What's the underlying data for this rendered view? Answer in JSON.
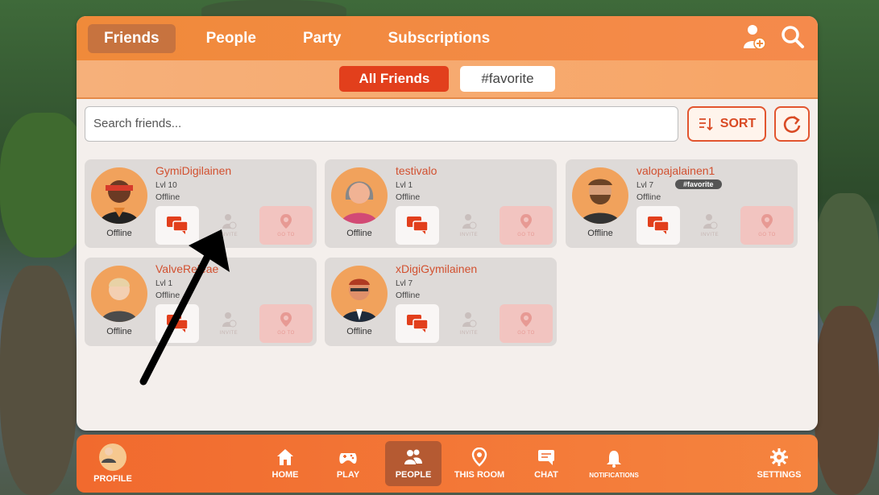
{
  "tabs": [
    "Friends",
    "People",
    "Party",
    "Subscriptions"
  ],
  "filters": {
    "all": "All Friends",
    "tag": "#favorite"
  },
  "search": {
    "placeholder": "Search friends..."
  },
  "sort_label": "SORT",
  "action_labels": {
    "invite": "INVITE",
    "goto": "GO TO"
  },
  "friends": [
    {
      "name": "GymiDigilainen",
      "level": "Lvl 10",
      "status": "Offline",
      "status_under": "Offline",
      "tag": ""
    },
    {
      "name": "testivalo",
      "level": "Lvl 1",
      "status": "Offline",
      "status_under": "Offline",
      "tag": ""
    },
    {
      "name": "valopajalainen1",
      "level": "Lvl 7",
      "status": "Offline",
      "status_under": "Offline",
      "tag": "#favorite"
    },
    {
      "name": "ValveReleae",
      "level": "Lvl 1",
      "status": "Offline",
      "status_under": "Offline",
      "tag": ""
    },
    {
      "name": "xDigiGymilainen",
      "level": "Lvl 7",
      "status": "Offline",
      "status_under": "Offline",
      "tag": ""
    }
  ],
  "nav": {
    "profile": "PROFILE",
    "home": "HOME",
    "play": "PLAY",
    "people": "PEOPLE",
    "this_room": "THIS ROOM",
    "chat": "CHAT",
    "notifications": "NOTIFICATIONS",
    "settings": "SETTINGS"
  },
  "colors": {
    "accent": "#f08a3a",
    "active_chip": "#e23f1c",
    "name": "#d2502f"
  }
}
